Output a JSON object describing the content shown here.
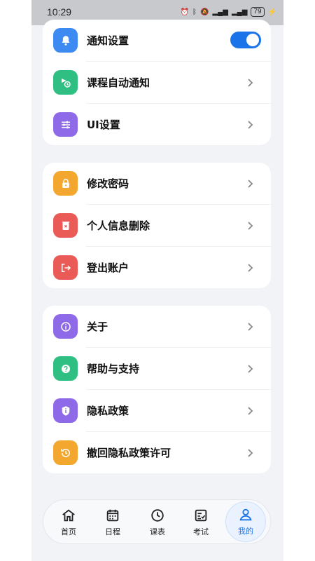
{
  "status_bar": {
    "time": "10:29",
    "battery": "79"
  },
  "sections": [
    {
      "items": [
        {
          "label": "通知设置",
          "icon": "bell-icon",
          "color": "#3d8bf2",
          "control": "toggle",
          "toggle_on": true
        },
        {
          "label": "课程自动通知",
          "icon": "clock-flag-icon",
          "color": "#2fbf82",
          "control": "chevron"
        },
        {
          "label": "UI设置",
          "icon": "sliders-icon",
          "color": "#8f6ae8",
          "control": "chevron"
        }
      ]
    },
    {
      "items": [
        {
          "label": "修改密码",
          "icon": "lock-icon",
          "color": "#f3a72e",
          "control": "chevron"
        },
        {
          "label": "个人信息删除",
          "icon": "trash-icon",
          "color": "#ea5a57",
          "control": "chevron"
        },
        {
          "label": "登出账户",
          "icon": "logout-icon",
          "color": "#ea5a57",
          "control": "chevron"
        }
      ]
    },
    {
      "items": [
        {
          "label": "关于",
          "icon": "info-icon",
          "color": "#8f6ae8",
          "control": "chevron"
        },
        {
          "label": "帮助与支持",
          "icon": "question-icon",
          "color": "#2fbf82",
          "control": "chevron"
        },
        {
          "label": "隐私政策",
          "icon": "shield-icon",
          "color": "#8f6ae8",
          "control": "chevron"
        },
        {
          "label": "撤回隐私政策许可",
          "icon": "history-icon",
          "color": "#f3a72e",
          "control": "chevron"
        }
      ]
    }
  ],
  "nav": {
    "items": [
      {
        "label": "首页",
        "icon": "home-icon"
      },
      {
        "label": "日程",
        "icon": "calendar-icon"
      },
      {
        "label": "课表",
        "icon": "clock-icon"
      },
      {
        "label": "考试",
        "icon": "exam-icon"
      },
      {
        "label": "我的",
        "icon": "user-icon",
        "active": true
      }
    ],
    "active_color": "#1a73e8"
  }
}
